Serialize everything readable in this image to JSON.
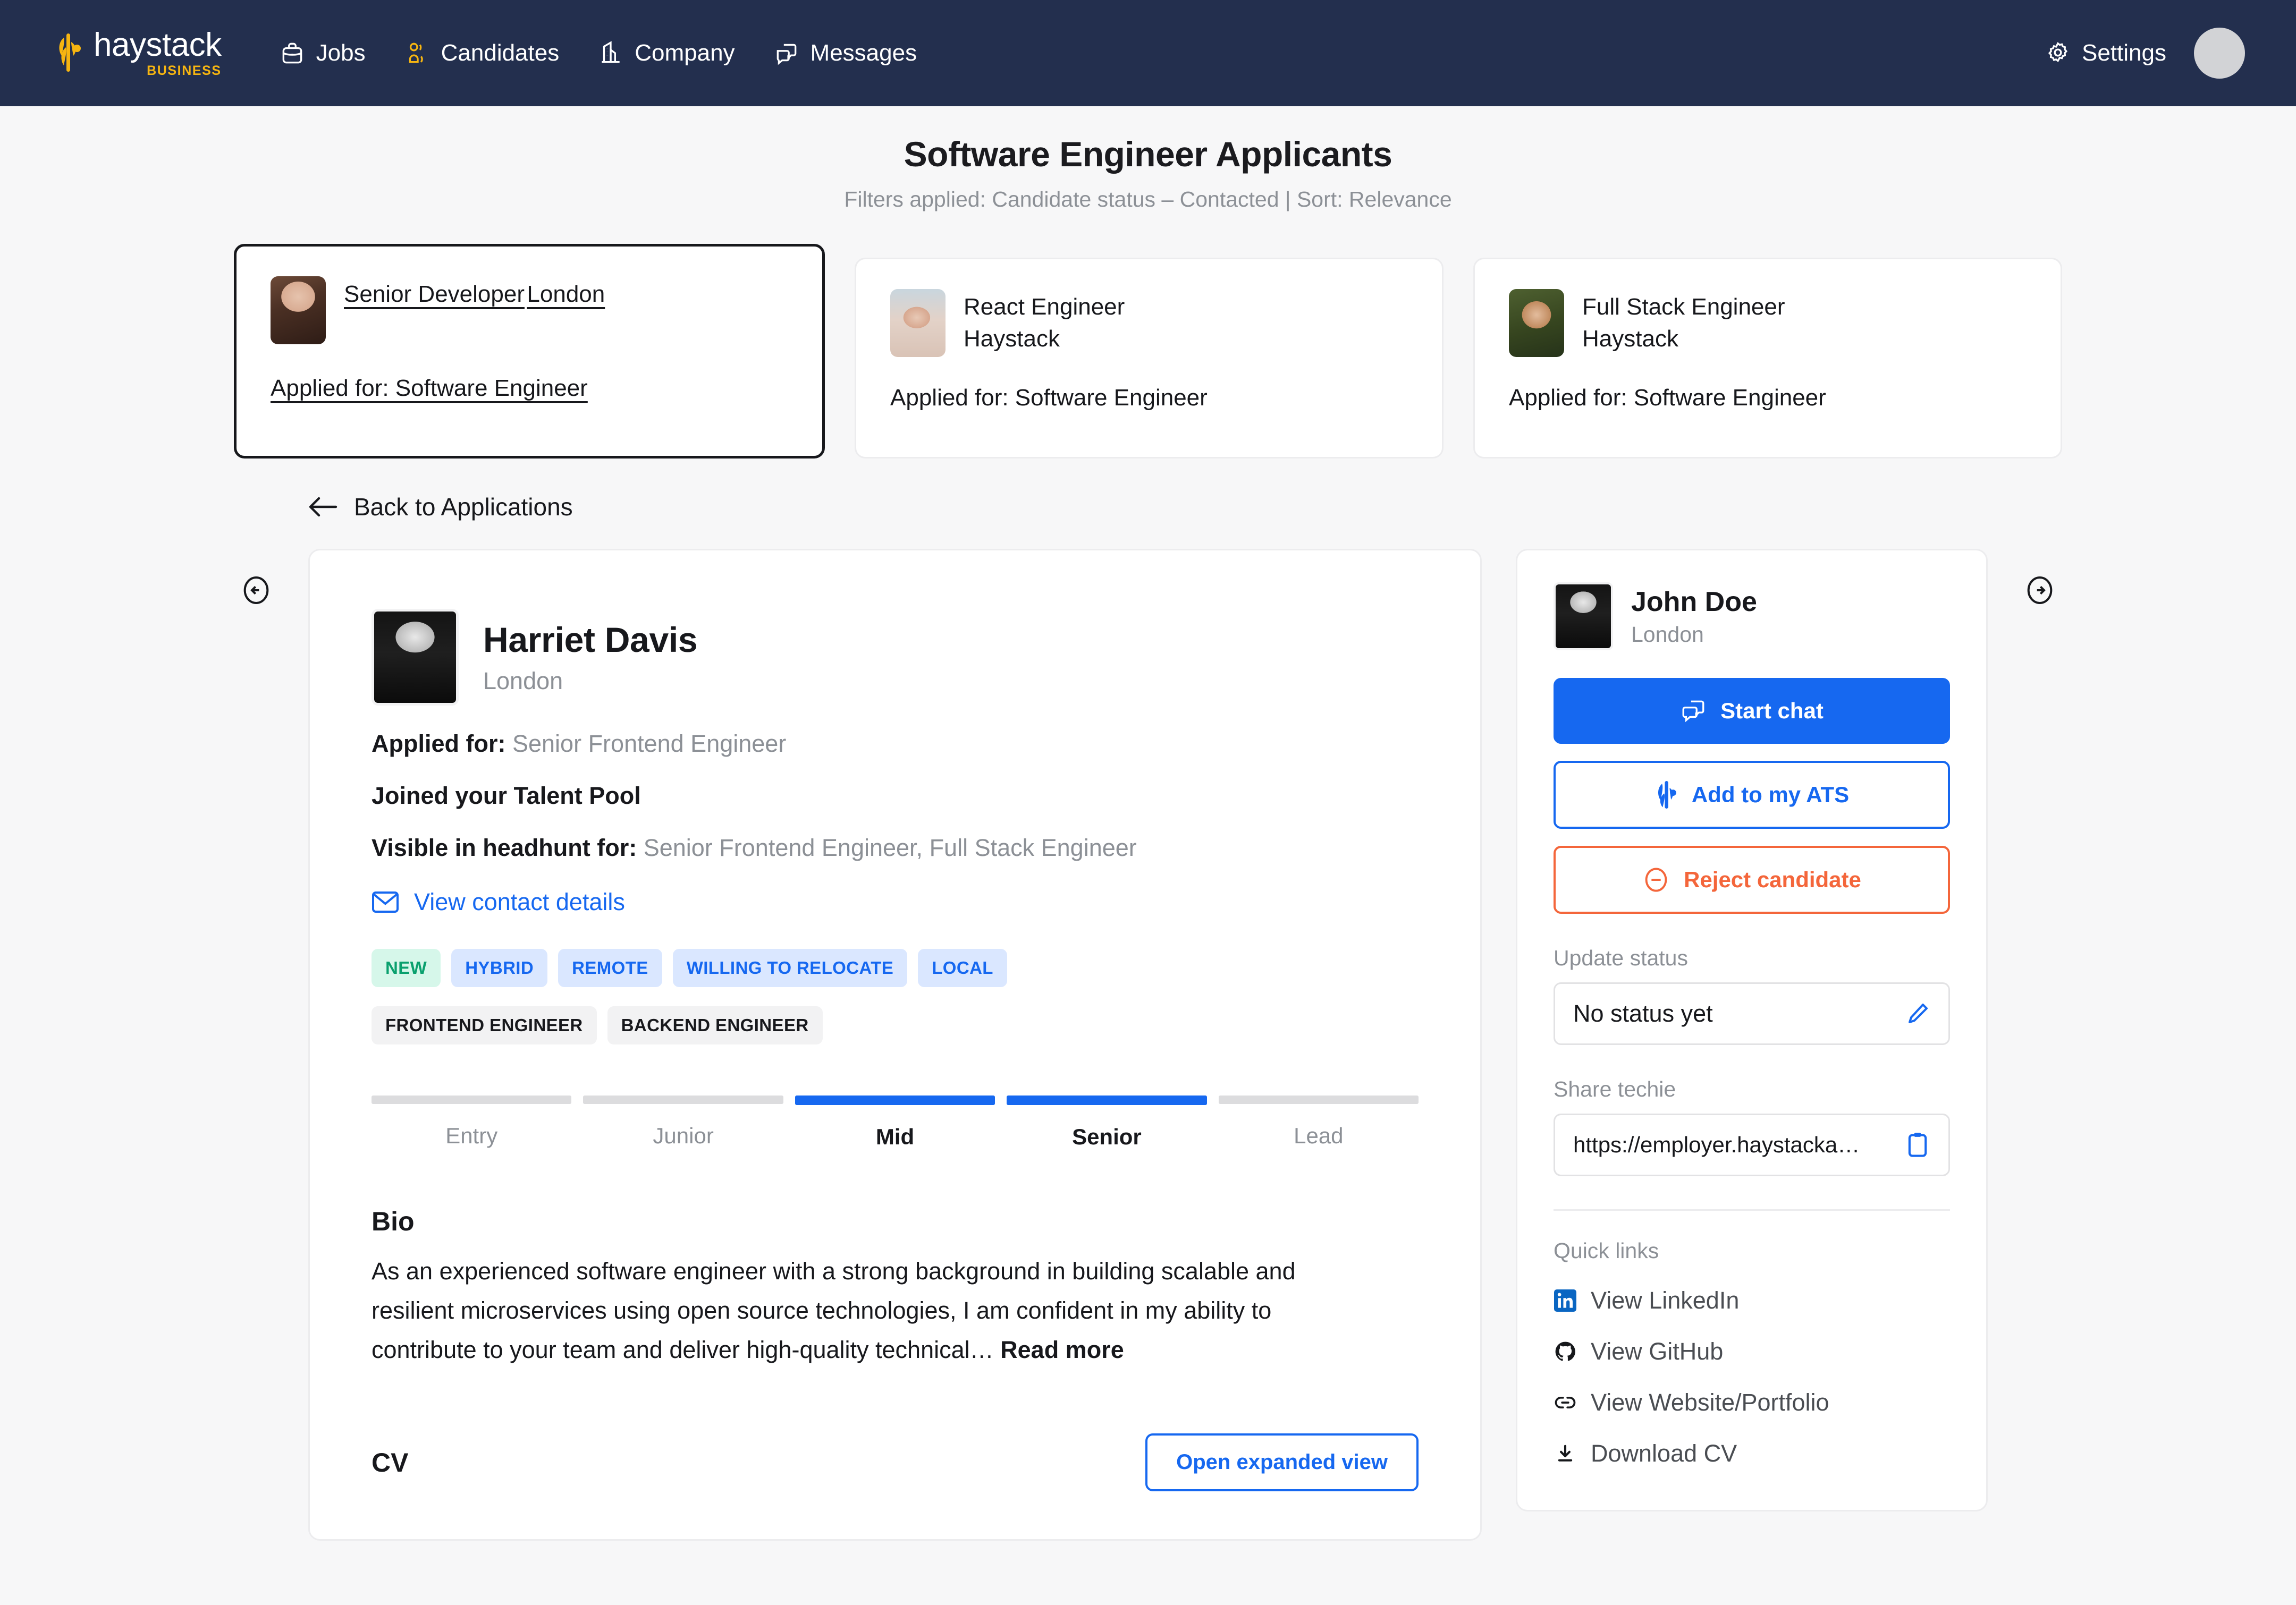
{
  "navbar": {
    "brand": {
      "word": "haystack",
      "sub": "BUSINESS",
      "logo_icon": "haystack-wheat-logo"
    },
    "items": [
      {
        "label": "Jobs",
        "icon": "briefcase-icon"
      },
      {
        "label": "Candidates",
        "icon": "users-icon"
      },
      {
        "label": "Company",
        "icon": "building-icon"
      },
      {
        "label": "Messages",
        "icon": "chat-bubbles-icon"
      }
    ],
    "settings": {
      "label": "Settings",
      "icon": "gear-icon"
    },
    "avatar": "user-avatar"
  },
  "page": {
    "title": "Software Engineer Applicants",
    "subtitle": "Filters applied: Candidate status – Contacted | Sort: Relevance"
  },
  "carousel": {
    "prev_icon": "arrow-left-circle-icon",
    "next_icon": "arrow-right-circle-icon",
    "cards": [
      {
        "role": "Senior Developer",
        "org": "London",
        "applied": "Applied for: Software Engineer",
        "selected": true
      },
      {
        "role": "React Engineer",
        "org": "Haystack",
        "applied": "Applied for: Software Engineer",
        "selected": false
      },
      {
        "role": "Full Stack Engineer",
        "org": "Haystack",
        "applied": "Applied for: Software Engineer",
        "selected": false
      }
    ]
  },
  "back_link": {
    "label": "Back to Applications",
    "icon": "arrow-left-icon"
  },
  "profile": {
    "name": "Harriet Davis",
    "location": "London",
    "applied_for_label": "Applied for:",
    "applied_for_value": "Senior Frontend Engineer",
    "talent_pool": "Joined your Talent Pool",
    "headhunt_label": "Visible in headhunt for:",
    "headhunt_value": "Senior Frontend Engineer, Full Stack Engineer",
    "contact_link": "View contact details",
    "contact_icon": "envelope-icon",
    "status_tags": [
      "NEW",
      "HYBRID",
      "REMOTE",
      "WILLING TO RELOCATE",
      "LOCAL"
    ],
    "role_tags": [
      "FRONTEND ENGINEER",
      "BACKEND ENGINEER"
    ],
    "levels": [
      {
        "label": "Entry",
        "active": false
      },
      {
        "label": "Junior",
        "active": false
      },
      {
        "label": "Mid",
        "active": true
      },
      {
        "label": "Senior",
        "active": true
      },
      {
        "label": "Lead",
        "active": false
      }
    ],
    "bio_title": "Bio",
    "bio_text": "As an experienced software engineer with a strong background in building scalable and resilient microservices using open source technologies, I am confident in my ability to contribute to your team and deliver high-quality technical… ",
    "read_more": "Read more",
    "cv_title": "CV",
    "cv_button": "Open expanded view"
  },
  "side_panel": {
    "name": "John Doe",
    "location": "London",
    "start_chat": {
      "label": "Start chat",
      "icon": "chat-icon"
    },
    "add_ats": {
      "label": "Add to my ATS",
      "icon": "haystack-mark-icon"
    },
    "reject": {
      "label": "Reject candidate",
      "icon": "minus-circle-icon"
    },
    "update_status_label": "Update status",
    "update_status_value": "No status yet",
    "update_status_icon": "pencil-icon",
    "share_label": "Share techie",
    "share_value": "https://employer.haystacka…",
    "share_icon": "clipboard-icon",
    "quick_links_title": "Quick links",
    "quick_links": [
      {
        "label": "View LinkedIn",
        "icon": "linkedin-icon"
      },
      {
        "label": "View GitHub",
        "icon": "github-icon"
      },
      {
        "label": "View Website/Portfolio",
        "icon": "link-icon"
      },
      {
        "label": "Download CV",
        "icon": "download-icon"
      }
    ]
  },
  "colors": {
    "navy": "#232f4e",
    "accent_blue": "#1668f0",
    "brand_yellow": "#f6b511",
    "reject_orange": "#f4663b",
    "new_green": "#0aa06e",
    "muted": "#8c9096"
  }
}
